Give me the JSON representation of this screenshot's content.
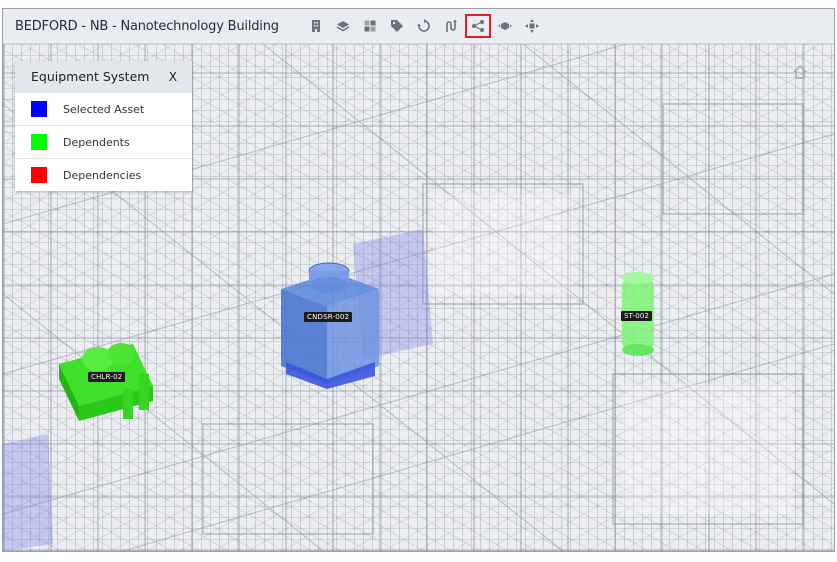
{
  "header": {
    "title": "BEDFORD - NB - Nanotechnology Building"
  },
  "toolbar": {
    "tools": [
      {
        "icon": "building-icon"
      },
      {
        "icon": "layers-icon"
      },
      {
        "icon": "grid-icon"
      },
      {
        "icon": "tag-icon"
      },
      {
        "icon": "rotate-icon"
      },
      {
        "icon": "route-icon"
      },
      {
        "icon": "share-nodes-icon",
        "active": true
      },
      {
        "icon": "explode-icon"
      },
      {
        "icon": "move-icon"
      }
    ]
  },
  "legend": {
    "title": "Equipment System",
    "close_label": "X",
    "items": [
      {
        "label": "Selected Asset",
        "color": "#0000ff"
      },
      {
        "label": "Dependents",
        "color": "#00ff00"
      },
      {
        "label": "Dependencies",
        "color": "#ff0000"
      }
    ]
  },
  "assets": {
    "condenser": {
      "label": "CNDSR-002",
      "color": "#3b6fd6"
    },
    "chiller": {
      "label": "CHLR-02",
      "color": "#33dd22"
    },
    "storage_tank": {
      "label": "ST-002",
      "color": "#5ef05a"
    }
  },
  "icons": {
    "home": "home-icon"
  }
}
